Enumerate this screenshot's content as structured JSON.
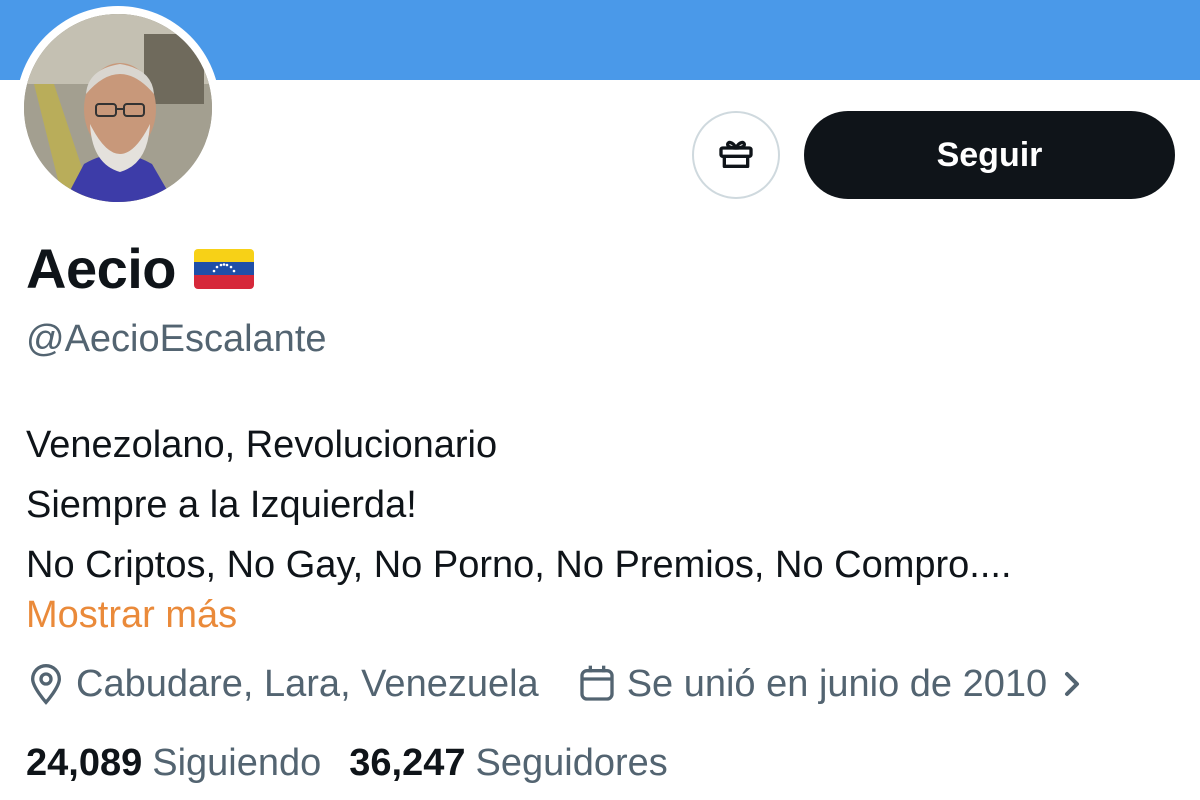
{
  "profile": {
    "display_name": "Aecio",
    "flag_icon": "venezuela-flag-icon",
    "handle": "@AecioEscalante",
    "bio_lines": [
      "Venezolano, Revolucionario",
      "Siempre a la Izquierda!",
      "No Criptos, No Gay, No Porno, No Premios, No Compro...."
    ],
    "show_more_label": "Mostrar más",
    "location": "Cabudare, Lara, Venezuela",
    "joined": "Se unió en junio de 2010",
    "following_count": "24,089",
    "following_label": "Siguiendo",
    "followers_count": "36,247",
    "followers_label": "Seguidores"
  },
  "actions": {
    "follow_label": "Seguir",
    "gift_icon": "gift-icon"
  },
  "colors": {
    "banner": "#4a99e9",
    "follow_button": "#0f1419",
    "show_more": "#ea8a3a",
    "secondary_text": "#536471"
  }
}
